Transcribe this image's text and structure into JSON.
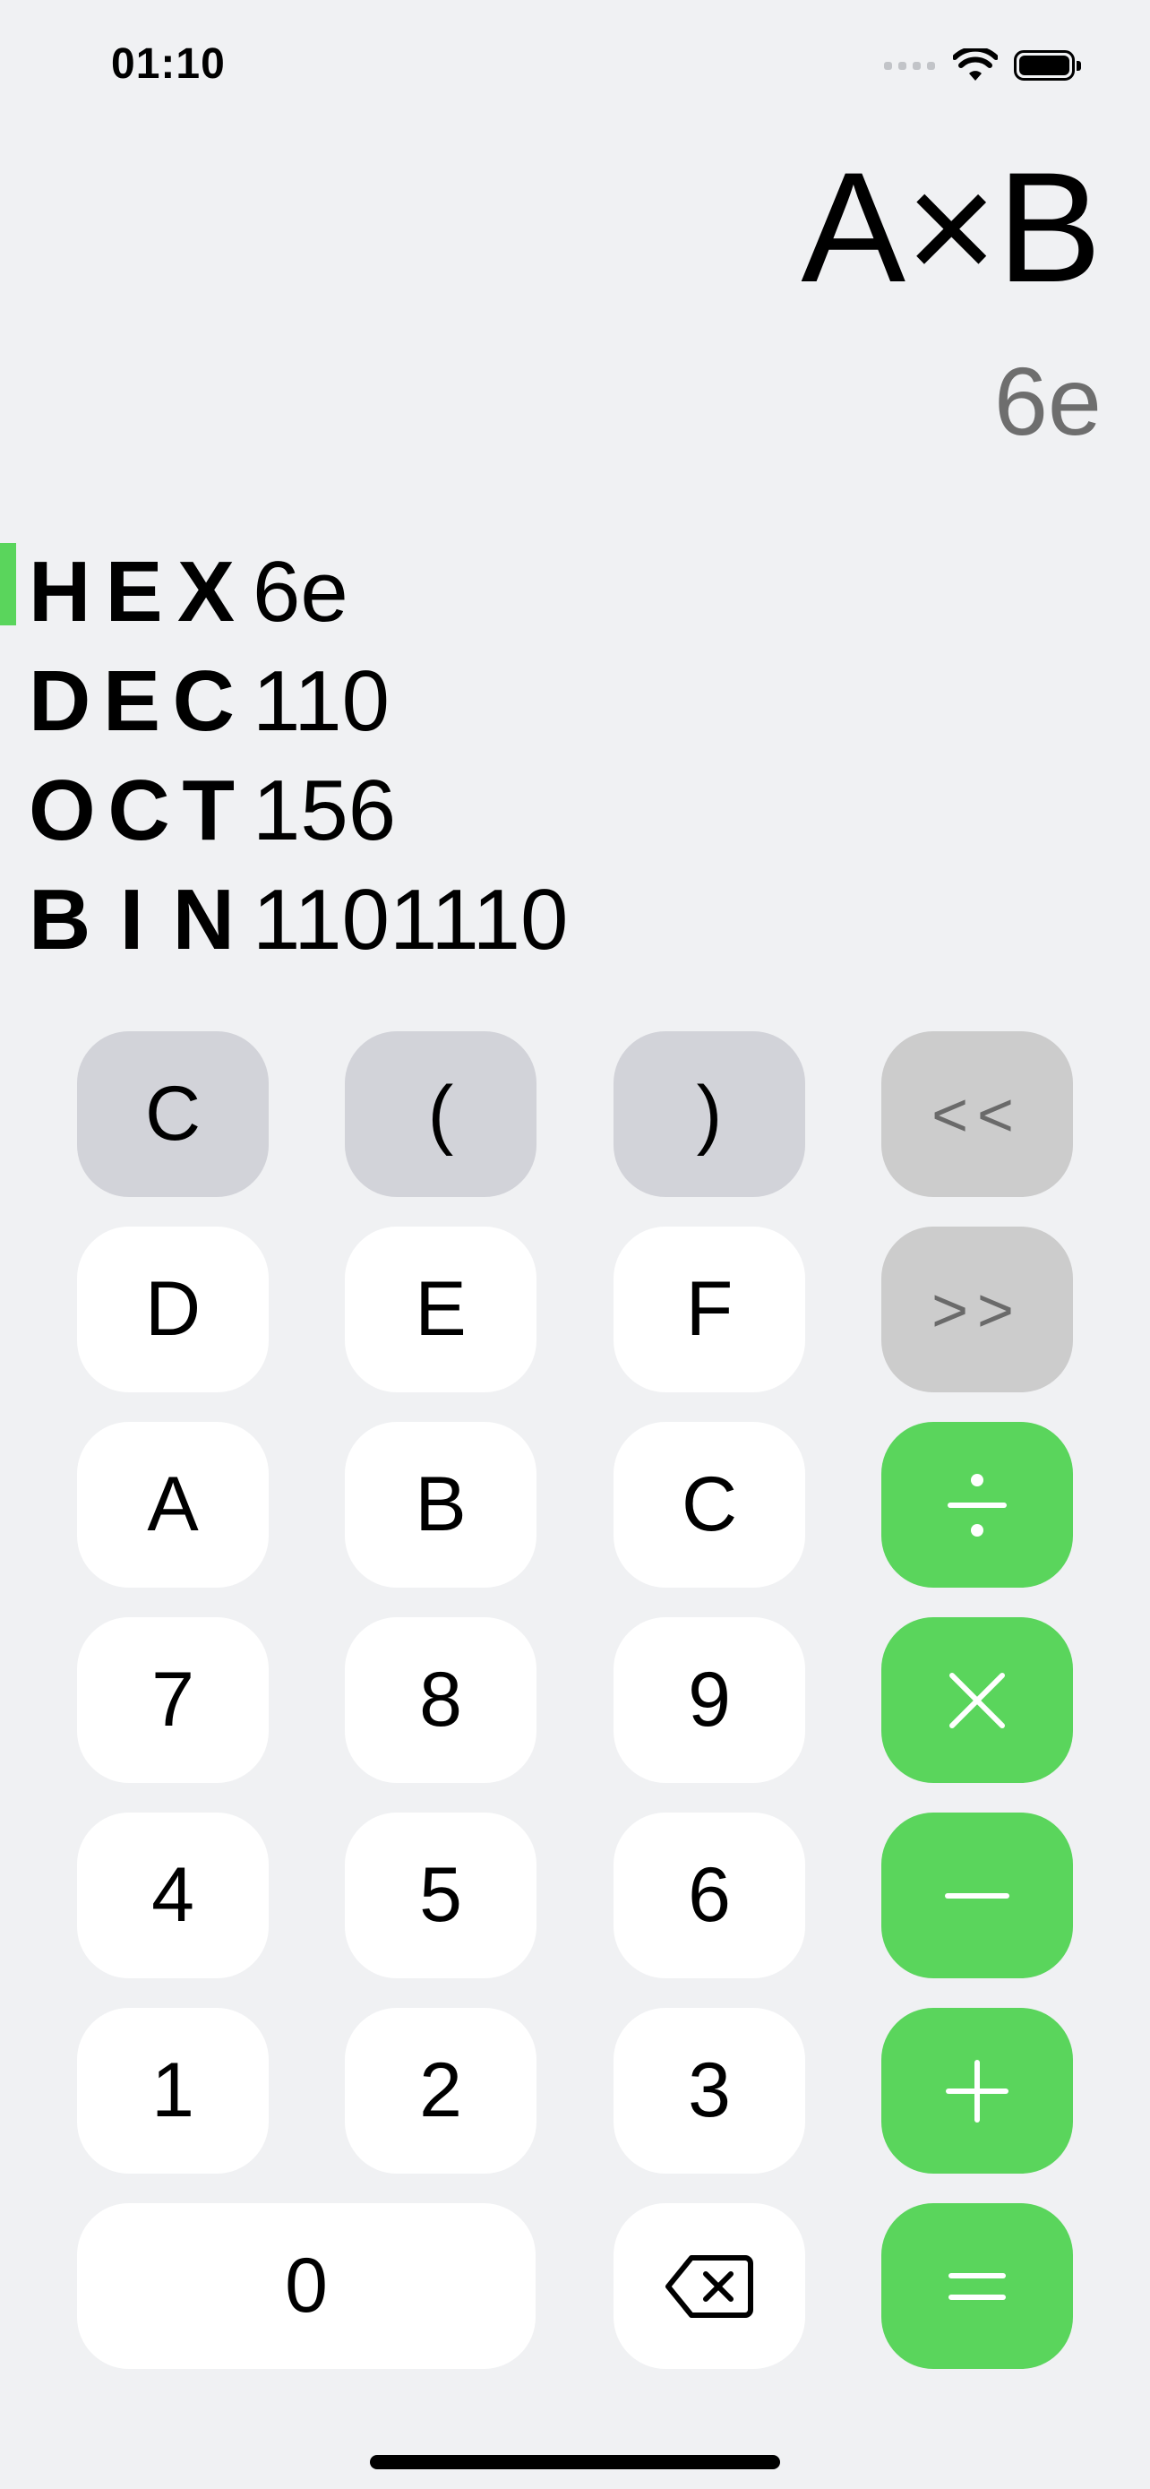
{
  "status_bar": {
    "time": "01:10"
  },
  "display": {
    "expression": "A×B",
    "result": "6e"
  },
  "bases": [
    {
      "label": [
        "H",
        "E",
        "X"
      ],
      "value": "6e",
      "active": true
    },
    {
      "label": [
        "D",
        "E",
        "C"
      ],
      "value": "110",
      "active": false
    },
    {
      "label": [
        "O",
        "C",
        "T"
      ],
      "value": "156",
      "active": false
    },
    {
      "label": [
        "B",
        "I",
        "N"
      ],
      "value": "1101110",
      "active": false
    }
  ],
  "keypad": {
    "clear": "C",
    "open_paren": "(",
    "close_paren": ")",
    "shift_left": "<<",
    "shift_right": ">>",
    "d": "D",
    "e": "E",
    "f": "F",
    "a": "A",
    "b": "B",
    "c": "C",
    "seven": "7",
    "eight": "8",
    "nine": "9",
    "four": "4",
    "five": "5",
    "six": "6",
    "one": "1",
    "two": "2",
    "three": "3",
    "zero": "0"
  },
  "icons": {
    "divide": "divide-icon",
    "multiply": "multiply-icon",
    "minus": "minus-icon",
    "plus": "plus-icon",
    "equals": "equals-icon",
    "backspace": "backspace-icon",
    "wifi": "wifi-icon",
    "battery": "battery-icon",
    "signal": "signal-icon"
  },
  "colors": {
    "accent": "#5ad55c",
    "background": "#f0f1f3",
    "function_key": "#d2d3d9",
    "shift_key": "#cccccc",
    "digit_key": "#ffffff"
  }
}
